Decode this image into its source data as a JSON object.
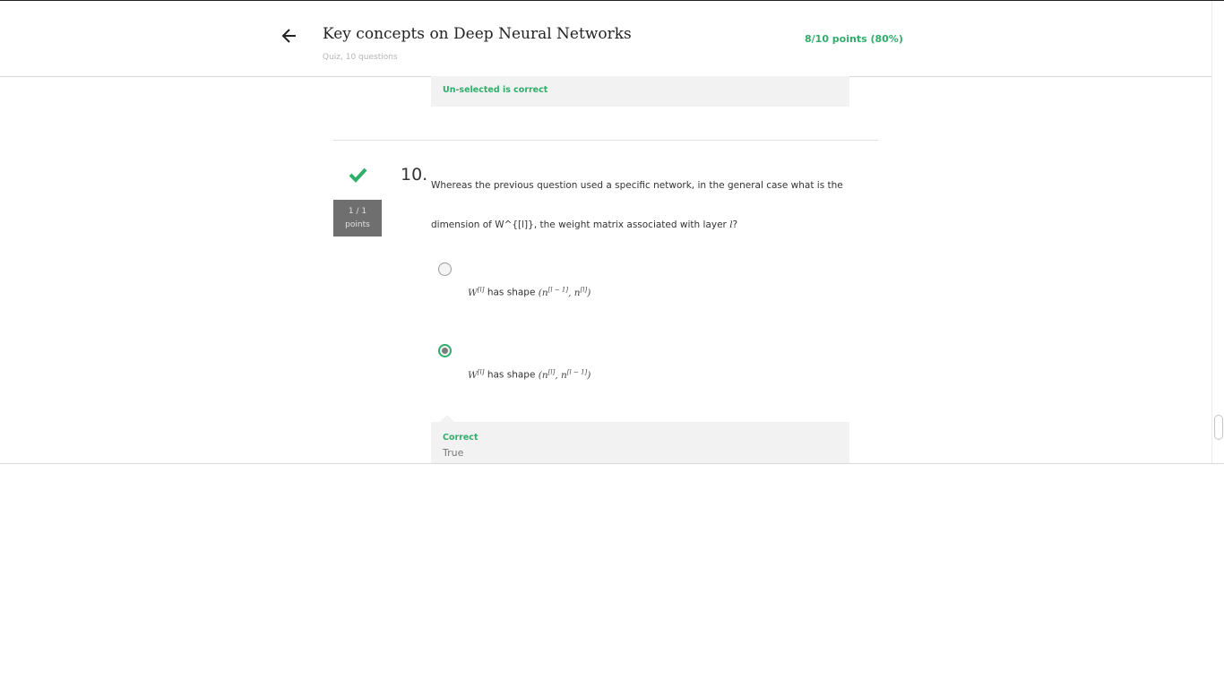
{
  "header": {
    "title": "Key concepts on Deep Neural Networks",
    "subtitle": "Quiz, 10 questions",
    "score": "8/10 points (80%)"
  },
  "previous_feedback": {
    "label": "Un-selected is correct"
  },
  "question": {
    "number": "10.",
    "points_line1": "1 / 1",
    "points_line2": "points",
    "text_part1": "Whereas the previous question used a specific network, in the general case what is the dimension of W^{[l]}, the weight matrix associated with layer ",
    "text_var": "l",
    "text_part2": "?",
    "options": [
      {
        "w": "W",
        "w_sup": "[l]",
        "mid": " has shape ",
        "shape_open": "(n",
        "sup1": "[l − 1]",
        "comma": ", n",
        "sup2": "[l]",
        "shape_close": ")",
        "selected": false
      },
      {
        "w": "W",
        "w_sup": "[l]",
        "mid": " has shape ",
        "shape_open": "(n",
        "sup1": "[l]",
        "comma": ", n",
        "sup2": "[l − 1]",
        "shape_close": ")",
        "selected": true
      }
    ],
    "feedback": {
      "label": "Correct",
      "text": "True"
    }
  },
  "colors": {
    "accent_green": "#2fae6a",
    "points_badge": "#6f6f6f",
    "feedback_bg": "#f2f2f2"
  },
  "icons": {
    "back": "arrow-left-icon",
    "status": "checkmark-icon"
  }
}
